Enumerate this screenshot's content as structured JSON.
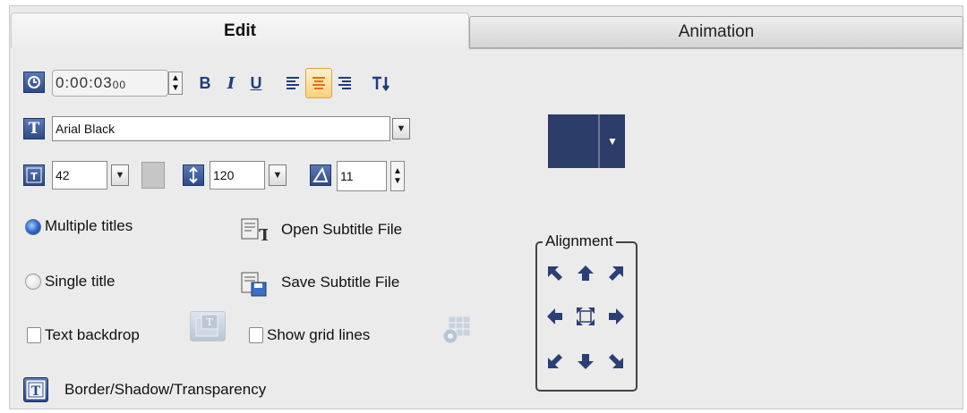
{
  "tabs": {
    "edit": "Edit",
    "animation": "Animation"
  },
  "toolbar": {
    "duration": "0:00:03",
    "duration_frames": "00",
    "bold": "B",
    "italic": "I",
    "underline": "U"
  },
  "font": {
    "name": "Arial Black"
  },
  "size": {
    "value": "42"
  },
  "line_spacing": {
    "value": "120"
  },
  "angle": {
    "value": "11"
  },
  "options": {
    "multiple_titles": "Multiple titles",
    "single_title": "Single title",
    "text_backdrop": "Text backdrop",
    "show_grid_lines": "Show grid lines",
    "open_subtitle": "Open Subtitle File",
    "save_subtitle": "Save Subtitle File",
    "border_shadow": "Border/Shadow/Transparency"
  },
  "alignment": {
    "label": "Alignment"
  },
  "colors": {
    "text_color": "#2d3d6a",
    "accent": "#1f3b80"
  }
}
